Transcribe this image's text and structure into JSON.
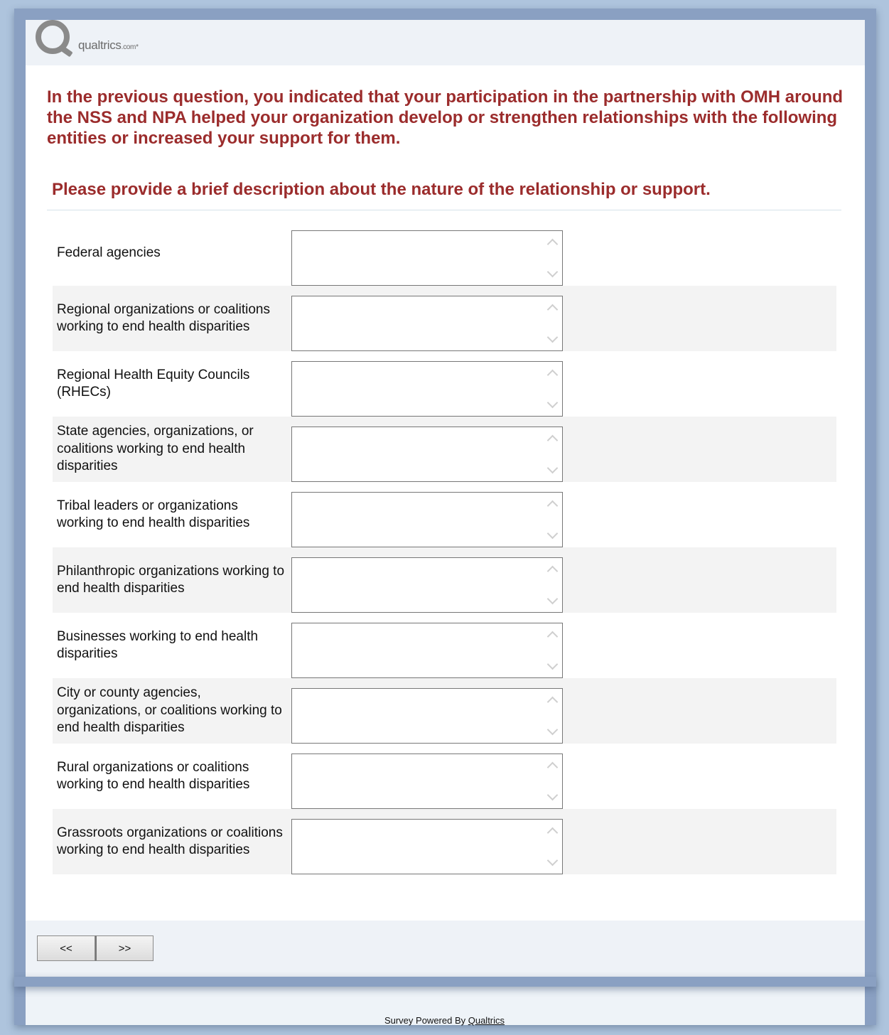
{
  "header": {
    "logo_text": "qualtrics",
    "logo_suffix": ".com"
  },
  "question": {
    "text": "In the previous question, you indicated that your participation in the partnership with OMH around the NSS and NPA helped your organization develop or strengthen relationships with the following entities or increased your support for them.",
    "subtext": "Please provide a brief description about the nature of the relationship or support."
  },
  "rows": [
    {
      "label": "Federal agencies",
      "value": ""
    },
    {
      "label": "Regional organizations or coalitions working to end health disparities",
      "value": ""
    },
    {
      "label": "Regional Health Equity Councils (RHECs)",
      "value": ""
    },
    {
      "label": "State agencies, organizations, or coalitions working to end health disparities",
      "value": ""
    },
    {
      "label": "Tribal leaders or organizations working to end health disparities",
      "value": ""
    },
    {
      "label": "Philanthropic organizations working to end health disparities",
      "value": ""
    },
    {
      "label": "Businesses working to end health disparities",
      "value": ""
    },
    {
      "label": "City or county agencies, organizations, or coalitions working to end health disparities",
      "value": ""
    },
    {
      "label": "Rural organizations or coalitions working to end health disparities",
      "value": ""
    },
    {
      "label": "Grassroots organizations or coalitions working to end health disparities",
      "value": ""
    }
  ],
  "nav": {
    "back_label": "<<",
    "next_label": ">>"
  },
  "footer": {
    "powered_prefix": "Survey Powered By ",
    "powered_link": "Qualtrics"
  },
  "colors": {
    "question_text": "#9b2c2c",
    "page_bg": "#aec4dd",
    "frame": "#8aa0c2"
  }
}
